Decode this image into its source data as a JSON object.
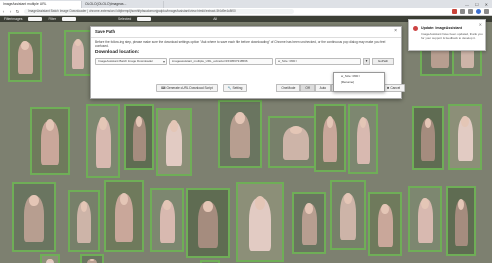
{
  "browser": {
    "tabs": [
      {
        "label": "ImageAssistant multiple URL"
      },
      {
        "label": "OLOLO(OLOLO)Imageas..."
      }
    ],
    "url": "ImageAssistant Batch Image Downloader | chrome-extension://dbjbempljhcmhlfpfacalomonjpalpko/imageAssistant/view.html#/extract-5f4d9e4c8f00",
    "window_controls": {
      "minimize": "—",
      "maximize": "☐",
      "close": "✕"
    }
  },
  "extension_bar": {
    "label1": "Filterimages",
    "label2": "Filter",
    "label3": "Selected",
    "label4": "All"
  },
  "modal": {
    "title": "Save Path",
    "close": "×",
    "description": "Before the follow-ing step, please make sure the download settings option \"Ask where to save each file before downloading\" of Chrome has been unchecked, or the continuous pop dialog may make you feel confused.",
    "download_label": "Download location:",
    "field1": "ImageAssistant Batch Image Downloader",
    "field2": "imageassistant_multiple_URL_extractor/1530567318566",
    "field3": "w_Size >800 / ",
    "arrow": "▾",
    "go_label": "GoPath",
    "actions": {
      "generate": "Generate cURL Download Script",
      "setting": "Setting",
      "mode_label": "OneMode",
      "modes": [
        "Off",
        "Auto",
        "Mode1"
      ],
      "save": "Save",
      "cancel": "Cancel"
    }
  },
  "dropdown": {
    "items": [
      "w_Size >800 /",
      "[Rename]"
    ]
  },
  "notification": {
    "title": "Update: ImageAssistant",
    "body": "ImageAssistant have been updated, thank you for your support & feedback to develop it.",
    "close": "✕"
  },
  "colors": {
    "page_bg": "#7d8070",
    "thumb_border": "#6fae57"
  }
}
